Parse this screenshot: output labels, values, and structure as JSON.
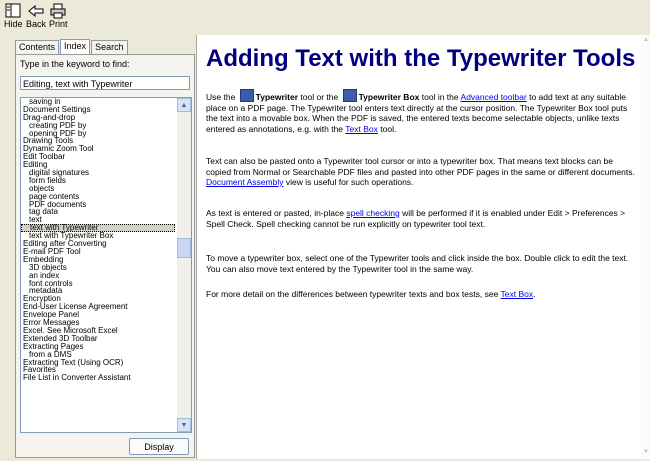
{
  "toolbar": {
    "hide_label": "Hide",
    "back_label": "Back",
    "print_label": "Print"
  },
  "tabs": [
    {
      "label": "Contents"
    },
    {
      "label": "Index"
    },
    {
      "label": "Search"
    }
  ],
  "keyword": {
    "label": "Type in the keyword to find:",
    "value": "Editing, text with Typewriter"
  },
  "index_items": [
    {
      "label": "saving in",
      "indent": true
    },
    {
      "label": "Document Settings",
      "indent": false
    },
    {
      "label": "Drag-and-drop",
      "indent": false
    },
    {
      "label": "creating PDF by",
      "indent": true
    },
    {
      "label": "opening PDF by",
      "indent": true
    },
    {
      "label": "Drawing Tools",
      "indent": false
    },
    {
      "label": "Dynamic Zoom Tool",
      "indent": false
    },
    {
      "label": "Edit Toolbar",
      "indent": false
    },
    {
      "label": "Editing",
      "indent": false
    },
    {
      "label": "digital signatures",
      "indent": true
    },
    {
      "label": "form fields",
      "indent": true
    },
    {
      "label": "objects",
      "indent": true
    },
    {
      "label": "page contents",
      "indent": true
    },
    {
      "label": "PDF documents",
      "indent": true
    },
    {
      "label": "tag data",
      "indent": true
    },
    {
      "label": "text",
      "indent": true
    },
    {
      "label": "text with Typewriter",
      "indent": true,
      "selected": true
    },
    {
      "label": "text with Typewriter Box",
      "indent": true
    },
    {
      "label": "Editing after Converting",
      "indent": false
    },
    {
      "label": "E-mail PDF Tool",
      "indent": false
    },
    {
      "label": "Embedding",
      "indent": false
    },
    {
      "label": "3D objects",
      "indent": true
    },
    {
      "label": "an index",
      "indent": true
    },
    {
      "label": "font controls",
      "indent": true
    },
    {
      "label": "metadata",
      "indent": true
    },
    {
      "label": "Encryption",
      "indent": false
    },
    {
      "label": "End-User License Agreement",
      "indent": false
    },
    {
      "label": "Envelope Panel",
      "indent": false
    },
    {
      "label": "Error Messages",
      "indent": false
    },
    {
      "label": "Excel. See Microsoft Excel",
      "indent": false
    },
    {
      "label": "Extended 3D Toolbar",
      "indent": false
    },
    {
      "label": "Extracting Pages",
      "indent": false
    },
    {
      "label": "from a DMS",
      "indent": true
    },
    {
      "label": "Extracting Text (Using OCR)",
      "indent": false
    },
    {
      "label": "Favorites",
      "indent": false
    },
    {
      "label": "File List in Converter Assistant",
      "indent": false
    }
  ],
  "display_label": "Display",
  "article": {
    "title": "Adding Text with the Typewriter Tools",
    "p1": {
      "t1": "Use the",
      "tool1": "Typewriter",
      "t2": "tool or the",
      "tool2": "Typewriter Box",
      "t3": "tool in the",
      "link1": "Advanced toolbar",
      "t4": "to add text at any suitable place on a PDF page. The Typewriter tool enters text directly at the cursor position. The Typewriter Box tool puts the text into a movable box. When the PDF is saved, the entered texts become selectable objects, unlike texts entered as annotations, e.g. with the",
      "link2": "Text Box",
      "t5": "tool."
    },
    "p2": {
      "t1": "Text can also be pasted onto a Typewriter tool cursor or into a typewriter box. That means text blocks can be copied from Normal or Searchable PDF files and pasted into other PDF pages in the same or different documents.",
      "link1": "Document Assembly",
      "t2": "view is useful for such operations."
    },
    "p3": {
      "t1": "As text is entered or pasted, in-place",
      "link1": "spell checking",
      "t2": "will be performed if it is enabled under Edit > Preferences > Spell Check. Spell checking cannot be run explicitly on typewriter tool text."
    },
    "p4": {
      "t1": "To move a typewriter box, select one of the Typewriter tools and click inside the box. Double click to edit the text. You can also move text entered by the Typewriter tool in the same way."
    },
    "p5": {
      "t1": "For more detail on the differences between typewriter texts and box tests, see",
      "link1": "Text Box",
      "t2": "."
    }
  }
}
